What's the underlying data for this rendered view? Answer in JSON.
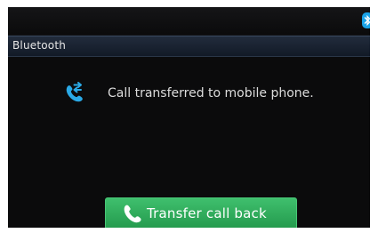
{
  "status_bar": {
    "icon": "bluetooth-icon",
    "icon_color": "#1aa3e8"
  },
  "header": {
    "title": "Bluetooth"
  },
  "message": {
    "icon": "call-transfer-icon",
    "icon_color": "#2aa9e6",
    "text": "Call transferred to mobile phone."
  },
  "action_button": {
    "icon": "phone-icon",
    "label": "Transfer call back",
    "color": "#2eaa59"
  }
}
